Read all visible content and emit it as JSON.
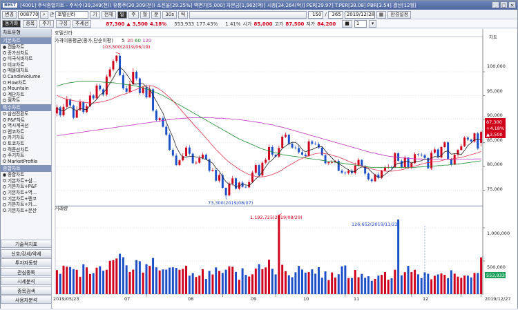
{
  "window": {
    "logo": "BEST",
    "title": "[4001] 주식종합차트 - 주식수(39,249(천)) 유통주(30,309(천)) 소진율[29.25%] 액면가[5,000] 자본금[1,962(억)] 시총[34,264(억)] PER[29.97] T.PER[38.08] PBR[3.54] 결산[12월]",
    "controls": [
      "_",
      "□",
      "×"
    ]
  },
  "toolbar1": {
    "mode": "변경",
    "code": "008770",
    "name_label": "관",
    "name": "호텔신라",
    "buttons": [
      "기",
      "전체",
      "일",
      "주",
      "월",
      "분",
      "30s",
      "틱"
    ],
    "count": "150",
    "total": "365",
    "date": "2019/12/28",
    "settings": "환경설정"
  },
  "toolbar2": {
    "tabs": [
      "동기화",
      "종목",
      "주기",
      "구성",
      "추세선"
    ],
    "price": "87,300",
    "change": "3,500",
    "change_pct": "4.18%",
    "volume": "553,933",
    "turnover_pct": "177.43%",
    "vol_ratio": "1.41%",
    "open_label": "시가",
    "open": "85,000",
    "high_label": "고가",
    "high": "87,500",
    "low_label": "저가",
    "low": "84,200",
    "page": "1"
  },
  "sidebar": {
    "header": "차트유형",
    "sections": [
      {
        "title": "기본차트",
        "items": [
          "캔들차트",
          "종가선차트",
          "미국식바차트",
          "비교차트",
          "매물대차트",
          "CandleVolume",
          "Flow차트",
          "Mountain",
          "계단차트",
          "점차트"
        ]
      },
      {
        "title": "특수차트",
        "items": [
          "삼선전환도",
          "P&F차트",
          "역시계곡선",
          "렌코차트",
          "카기차트",
          "토코차트",
          "적준선차트",
          "주기차트",
          "MarketProfile"
        ]
      },
      {
        "title": "종합차트",
        "items": [
          "종합차트",
          "기본차트+삼...",
          "기본차트+P&F",
          "기본차트+역...",
          "기본차트+렌코",
          "기본차트+카...",
          "기본차트+분산"
        ]
      }
    ],
    "buttons": [
      "기술적지표",
      "신호/강세/약세",
      "투자자동향",
      "관심종목",
      "시세분석",
      "종목검색",
      "사용자분석"
    ]
  },
  "chart": {
    "stock_name": "호텔신라",
    "price_panel_title": "가격이동평균(종가,단순이평)",
    "ma_labels": [
      "5",
      "20",
      "60",
      "120"
    ],
    "volume_panel_title": "거래량",
    "annot_high": "103,500(2019/06/19)",
    "annot_low": "73,300(2019/08/07)",
    "annot_vol_max": "1,192,725(2019/08/29)",
    "annot_vol_2": "126,652(2019/11/22)",
    "price_ticks": [
      "100,000",
      "95,000",
      "90,000",
      "85,000",
      "80,000",
      "75,000"
    ],
    "vol_ticks": [
      "1,000,000",
      "500,000"
    ],
    "x_labels": [
      "2019/05/23",
      "07",
      "08",
      "09",
      "10",
      "11",
      "12",
      "2019/12/27"
    ],
    "cur_price": "87,300",
    "cur_pct": "+4.18%",
    "cur_chg": "▲3,500",
    "cur_vol": "553,933",
    "side_label": "차트"
  },
  "chart_data": {
    "type": "bar",
    "title": "호텔신라",
    "xlabel": "",
    "ylabel": "",
    "ylim": [
      72000,
      107000
    ],
    "colors": {
      "up": "#d0021b",
      "down": "#1b50c8",
      "ma5": "#222222",
      "ma20": "#e03050",
      "ma60": "#1a8c2c",
      "ma120": "#c030c0"
    },
    "close": [
      92500,
      90800,
      92600,
      94200,
      92900,
      90300,
      91900,
      93600,
      91500,
      92700,
      95000,
      94400,
      97100,
      96300,
      95200,
      99000,
      100500,
      102300,
      103400,
      99300,
      96500,
      95800,
      97400,
      100000,
      98600,
      95500,
      96700,
      94600,
      96300,
      91800,
      89800,
      90200,
      88400,
      86700,
      83500,
      82300,
      80300,
      81300,
      82200,
      84000,
      82700,
      80700,
      80800,
      81800,
      82500,
      81500,
      79100,
      79300,
      77000,
      78200,
      75500,
      73900,
      76400,
      77500,
      75300,
      76600,
      75700,
      75600,
      76700,
      78700,
      80300,
      78100,
      80800,
      81400,
      84100,
      82500,
      82100,
      83900,
      86300,
      86700,
      84800,
      84000,
      83900,
      83000,
      82500,
      82200,
      85300,
      84800,
      84700,
      84000,
      82400,
      80700,
      80900,
      80900,
      81200,
      79100,
      78700,
      78600,
      79100,
      78600,
      80200,
      81400,
      80100,
      78500,
      77300,
      76900,
      78300,
      77600,
      79100,
      79800,
      79900,
      79800,
      82800,
      81200,
      79800,
      81900,
      79800,
      80700,
      82600,
      82500,
      82400,
      81800,
      79600,
      82900,
      83600,
      81900,
      84100,
      85100,
      81600,
      80400,
      82500,
      83500,
      84300,
      86100,
      85700,
      85300,
      87000,
      83800,
      87300
    ],
    "open": [
      91200,
      92500,
      90800,
      92600,
      94200,
      92900,
      90300,
      91900,
      93600,
      91500,
      92700,
      95000,
      94400,
      97100,
      96300,
      95200,
      99000,
      100500,
      102300,
      103400,
      99300,
      96500,
      95800,
      97400,
      100000,
      98600,
      95500,
      96700,
      94600,
      96300,
      91800,
      89800,
      90200,
      88400,
      86700,
      83500,
      82300,
      80300,
      81300,
      82200,
      84000,
      82700,
      80700,
      80800,
      81800,
      82500,
      81500,
      79100,
      79300,
      77000,
      78200,
      75500,
      73900,
      76400,
      77500,
      75300,
      76600,
      75700,
      75600,
      76700,
      78700,
      80300,
      78100,
      80800,
      81400,
      84100,
      82500,
      82100,
      83900,
      86300,
      86700,
      84800,
      84000,
      83900,
      83000,
      82500,
      82200,
      85300,
      84800,
      84700,
      84000,
      82400,
      80700,
      80900,
      80900,
      81200,
      79100,
      78700,
      78600,
      79100,
      78600,
      80200,
      81400,
      80100,
      78500,
      77300,
      76900,
      78300,
      77600,
      79100,
      79800,
      79900,
      79800,
      82800,
      81200,
      79800,
      81900,
      79800,
      80700,
      82600,
      82500,
      82400,
      81800,
      79600,
      82900,
      83600,
      81900,
      84100,
      85100,
      81600,
      80400,
      82500,
      83500,
      84300,
      86100,
      85700,
      85300,
      87000,
      85000
    ],
    "high": [
      93100,
      92800,
      93200,
      94900,
      94400,
      93100,
      92700,
      94200,
      93800,
      93200,
      95800,
      95300,
      97500,
      97500,
      96600,
      99400,
      101000,
      102700,
      103500,
      103800,
      99800,
      97100,
      98100,
      100800,
      100300,
      98800,
      97000,
      97300,
      97100,
      96600,
      92100,
      90500,
      90600,
      88800,
      87100,
      83900,
      82800,
      81500,
      82800,
      84400,
      84500,
      82900,
      81200,
      82300,
      82900,
      82800,
      81700,
      79700,
      79600,
      78600,
      78600,
      75600,
      76800,
      78000,
      77700,
      76800,
      77000,
      76100,
      77200,
      79100,
      80700,
      80600,
      81100,
      81800,
      84600,
      84500,
      82600,
      84400,
      86700,
      87200,
      86900,
      85200,
      84400,
      84400,
      83500,
      82800,
      85800,
      85600,
      85300,
      85100,
      84100,
      82600,
      81100,
      81300,
      81300,
      81500,
      79500,
      79000,
      79400,
      79400,
      80800,
      81800,
      81500,
      80300,
      78700,
      77600,
      78500,
      78800,
      79300,
      80200,
      80500,
      80200,
      83100,
      83000,
      81500,
      82300,
      81900,
      81000,
      83000,
      82800,
      82900,
      82700,
      81900,
      83400,
      84000,
      83900,
      84300,
      85300,
      85300,
      81800,
      82800,
      83700,
      84800,
      86400,
      86400,
      85800,
      87200,
      87300,
      87500
    ],
    "low": [
      90600,
      90400,
      90500,
      92300,
      92700,
      90000,
      90200,
      91700,
      91100,
      91300,
      92600,
      94000,
      94200,
      95900,
      94800,
      94800,
      98600,
      100100,
      101900,
      99100,
      96200,
      95500,
      95500,
      97100,
      98200,
      95100,
      95200,
      94300,
      94500,
      91500,
      89500,
      89400,
      88200,
      86400,
      83300,
      82000,
      80100,
      80100,
      81100,
      82000,
      82300,
      80500,
      80400,
      80600,
      81500,
      81300,
      78800,
      78900,
      76700,
      76600,
      75300,
      73300,
      73700,
      76000,
      75100,
      75000,
      75500,
      75400,
      75400,
      76500,
      78400,
      77900,
      77800,
      80500,
      81100,
      82100,
      81900,
      81800,
      83800,
      86000,
      84500,
      83700,
      83600,
      82700,
      82300,
      81900,
      82000,
      84500,
      84500,
      83700,
      82200,
      80400,
      80300,
      80600,
      80800,
      79000,
      78400,
      78200,
      78300,
      78300,
      78300,
      80000,
      80000,
      78100,
      77000,
      76600,
      76700,
      77300,
      77400,
      79000,
      79500,
      79400,
      79700,
      81000,
      79600,
      79600,
      79500,
      79400,
      80500,
      82100,
      82100,
      81600,
      79500,
      79300,
      82700,
      81700,
      81700,
      83900,
      81500,
      80100,
      80300,
      82100,
      83300,
      84100,
      85400,
      85100,
      85000,
      83500,
      84200
    ],
    "volume": [
      362500,
      305900,
      429300,
      413600,
      409500,
      378000,
      366400,
      262000,
      450700,
      403600,
      303600,
      317300,
      399000,
      421700,
      353200,
      367500,
      502500,
      512800,
      537800,
      609200,
      556400,
      434100,
      333900,
      369000,
      513500,
      497000,
      324800,
      452700,
      426600,
      544800,
      404300,
      357500,
      372200,
      369300,
      400300,
      404000,
      395600,
      367100,
      380900,
      428200,
      278200,
      317700,
      258700,
      278500,
      374900,
      228700,
      351500,
      296600,
      403200,
      350500,
      319700,
      368700,
      418800,
      412600,
      335500,
      215800,
      390200,
      290200,
      264900,
      298600,
      386500,
      452300,
      376500,
      403500,
      518600,
      381700,
      297700,
      1192725,
      442000,
      346900,
      285000,
      255300,
      329800,
      426200,
      370700,
      324100,
      331900,
      373100,
      308400,
      406700,
      247000,
      343400,
      211900,
      326000,
      249600,
      299800,
      419800,
      432300,
      242600,
      243300,
      364800,
      254700,
      304900,
      246500,
      269600,
      200300,
      229700,
      278400,
      290000,
      333400,
      216200,
      240100,
      367700,
      1126652,
      283000,
      331100,
      426600,
      331700,
      366800,
      298800,
      241900,
      328600,
      307100,
      223800,
      276600,
      296400,
      311700,
      292000,
      238900,
      359900,
      308700,
      263700,
      245000,
      280400,
      279200,
      252200,
      319500,
      319700,
      553933
    ],
    "ma5": [
      92300,
      91900,
      91700,
      92200,
      92600,
      92100,
      91800,
      92300,
      92100,
      92000,
      92900,
      93500,
      94200,
      95100,
      95600,
      96400,
      97600,
      98700,
      100000,
      100900,
      100400,
      99500,
      98500,
      97400,
      97400,
      97500,
      97500,
      96800,
      96400,
      95000,
      93800,
      92500,
      91300,
      89400,
      87700,
      86200,
      84200,
      82900,
      81900,
      82000,
      82100,
      82200,
      82000,
      82000,
      81700,
      81500,
      81100,
      80700,
      79700,
      79000,
      77800,
      76800,
      76200,
      76300,
      75700,
      75900,
      76300,
      76100,
      76000,
      76600,
      77400,
      77900,
      78900,
      79900,
      80900,
      81400,
      82200,
      82800,
      83800,
      84300,
      84800,
      85100,
      85100,
      84500,
      83600,
      83100,
      83400,
      83600,
      83900,
      84200,
      84200,
      83300,
      82500,
      81800,
      81000,
      80600,
      80200,
      79700,
      79300,
      78800,
      79000,
      79600,
      79900,
      79800,
      79500,
      78800,
      78200,
      77700,
      77800,
      78300,
      78900,
      79300,
      80300,
      80700,
      80700,
      81100,
      81100,
      80700,
      81000,
      81100,
      81200,
      81600,
      81400,
      81800,
      82100,
      82000,
      82300,
      83100,
      83300,
      82600,
      82700,
      82700,
      82500,
      83400,
      84400,
      85000,
      85700,
      85600,
      85800
    ],
    "ma20": [
      95000,
      94700,
      94400,
      94200,
      94100,
      93900,
      93800,
      93700,
      93600,
      93500,
      93400,
      93400,
      93500,
      93600,
      93700,
      93900,
      94100,
      94400,
      94700,
      95000,
      95200,
      95400,
      95700,
      96000,
      96300,
      96600,
      96900,
      97000,
      97100,
      97000,
      96700,
      96300,
      95800,
      95200,
      94600,
      93900,
      93100,
      92300,
      91500,
      90700,
      89900,
      89100,
      88300,
      87600,
      86800,
      86000,
      85200,
      84400,
      83600,
      82900,
      82200,
      81500,
      80900,
      80400,
      79900,
      79400,
      79000,
      78600,
      78300,
      78100,
      77900,
      77800,
      77800,
      77900,
      78100,
      78300,
      78600,
      78900,
      79300,
      79800,
      80200,
      80600,
      81000,
      81400,
      81700,
      82000,
      82300,
      82500,
      82700,
      82800,
      82800,
      82700,
      82600,
      82400,
      82200,
      82000,
      81700,
      81400,
      81100,
      80800,
      80600,
      80400,
      80100,
      79900,
      79700,
      79500,
      79300,
      79200,
      79100,
      79000,
      79000,
      79000,
      79100,
      79200,
      79300,
      79500,
      79700,
      79900,
      80100,
      80300,
      80500,
      80700,
      80800,
      80900,
      81000,
      81100,
      81200,
      81400,
      81500,
      81600,
      81700,
      81800,
      81900,
      82100,
      82300,
      82500,
      82700,
      82900,
      83200
    ],
    "ma60": [
      97000,
      97200,
      97400,
      97600,
      97700,
      97800,
      97900,
      98000,
      98000,
      98000,
      98000,
      98000,
      97900,
      97900,
      97800,
      97800,
      97700,
      97700,
      97600,
      97500,
      97400,
      97300,
      97200,
      97100,
      97000,
      96800,
      96600,
      96400,
      96200,
      95900,
      95600,
      95300,
      95000,
      94600,
      94200,
      93800,
      93400,
      93000,
      92600,
      92200,
      91800,
      91400,
      91000,
      90600,
      90200,
      89800,
      89400,
      89000,
      88600,
      88200,
      87800,
      87400,
      87000,
      86600,
      86200,
      85800,
      85500,
      85200,
      84900,
      84600,
      84300,
      84000,
      83700,
      83500,
      83300,
      83100,
      82900,
      82700,
      82500,
      82400,
      82300,
      82200,
      82100,
      82000,
      81900,
      81800,
      81700,
      81600,
      81500,
      81400,
      81300,
      81200,
      81100,
      81000,
      80900,
      80800,
      80700,
      80600,
      80500,
      80400,
      80300,
      80200,
      80100,
      80000,
      79900,
      79800,
      79800,
      79800,
      79800,
      79800,
      79800,
      79800,
      79800,
      79800,
      79800,
      79800,
      79800,
      79800,
      79800,
      79900,
      79900,
      80000,
      80000,
      80100,
      80100,
      80200,
      80200,
      80300,
      80300,
      80400,
      80500,
      80500,
      80600,
      80700,
      80800,
      80900,
      81000,
      81100,
      81200
    ],
    "ma120": [
      86500,
      86600,
      86700,
      86800,
      86900,
      87000,
      87100,
      87200,
      87300,
      87400,
      87500,
      87600,
      87700,
      87800,
      87900,
      88000,
      88100,
      88200,
      88300,
      88400,
      88500,
      88600,
      88700,
      88800,
      88900,
      89000,
      89100,
      89200,
      89300,
      89400,
      89500,
      89600,
      89700,
      89800,
      89900,
      90000,
      90100,
      90100,
      90200,
      90200,
      90300,
      90300,
      90300,
      90300,
      90300,
      90300,
      90300,
      90300,
      90200,
      90200,
      90200,
      90100,
      90100,
      90000,
      90000,
      89900,
      89800,
      89700,
      89600,
      89500,
      89400,
      89300,
      89200,
      89000,
      88900,
      88800,
      88600,
      88400,
      88300,
      88100,
      87900,
      87700,
      87500,
      87300,
      87100,
      86900,
      86700,
      86500,
      86300,
      86100,
      85900,
      85700,
      85500,
      85300,
      85100,
      84900,
      84700,
      84500,
      84300,
      84100,
      83900,
      83700,
      83500,
      83300,
      83100,
      82900,
      82800,
      82600,
      82500,
      82300,
      82200,
      82100,
      82000,
      81900,
      81800,
      81800,
      81700,
      81700,
      81600,
      81600,
      81600,
      81500,
      81500,
      81500,
      81500,
      81500,
      81500,
      81500,
      81500,
      81500,
      81500,
      81500,
      81500,
      81500,
      81500,
      81500,
      81600,
      81600,
      81600
    ]
  }
}
